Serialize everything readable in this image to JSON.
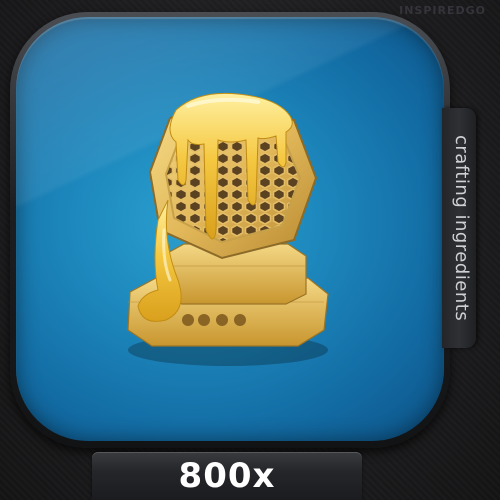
{
  "watermark": "INSPIREDGO",
  "item": {
    "icon": "honeycomb-icon",
    "category_label": "crafting ingredients",
    "quantity": "800x"
  },
  "colors": {
    "panel_blue": "#1d88bd",
    "honey_gold": "#f2c84b",
    "frame_dark": "#1d1e21"
  }
}
